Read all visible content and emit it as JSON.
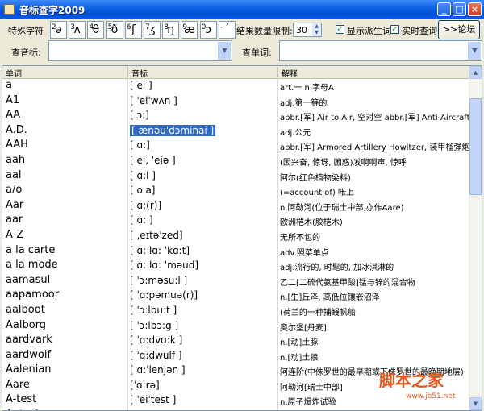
{
  "window": {
    "title": "音标查字2009"
  },
  "toolbar": {
    "special_chars_label": "特殊字符",
    "symbols": [
      {
        "sup": "2",
        "glyph": "ə"
      },
      {
        "sup": "3",
        "glyph": "ʌ"
      },
      {
        "sup": "4",
        "glyph": "θ"
      },
      {
        "sup": "5",
        "glyph": "ð"
      },
      {
        "sup": "6",
        "glyph": "ʃ"
      },
      {
        "sup": "7",
        "glyph": "ʒ"
      },
      {
        "sup": "8",
        "glyph": "ŋ"
      },
      {
        "sup": "9",
        "glyph": "æ"
      },
      {
        "sup": "0",
        "glyph": "ɔ"
      },
      {
        "sup": "-",
        "glyph": "ˊ"
      }
    ],
    "result_limit_label": "结果数量限制:",
    "result_limit_value": "30",
    "show_derived_label": "显示派生词",
    "live_query_label": "实时查询",
    "forum_label": ">>论坛"
  },
  "search": {
    "phonetic_label": "查音标:",
    "phonetic_value": "",
    "word_label": "查单词:",
    "word_value": ""
  },
  "list": {
    "columns": [
      "单词",
      "音标",
      "解释"
    ],
    "rows": [
      {
        "word": "a",
        "phonetic": "[ ei ]",
        "definition": "art.一 n.字母A"
      },
      {
        "word": "A1",
        "phonetic": "[ ˈeiˈwʌn ]",
        "definition": "adj.第一等的"
      },
      {
        "word": "AA",
        "phonetic": "[ ɔ:]",
        "definition": "abbr.[军] Air to Air, 空对空 abbr.[军] Anti-Aircraft, 防空"
      },
      {
        "word": "A.D.",
        "phonetic": "[ ænəuˈdɔminai ]",
        "definition": "adj.公元",
        "selected": true
      },
      {
        "word": "AAH",
        "phonetic": "[ ɑ:]",
        "definition": "abbr.[军] Armored Artillery Howitzer, 装甲榴弹炮 ab"
      },
      {
        "word": "aah",
        "phonetic": "[ ei, ˈeiə ]",
        "definition": "(因兴奋, 惊讶, 困惑)发啊啊声, 惊呼"
      },
      {
        "word": "aal",
        "phonetic": "[ ɑ:l ]",
        "definition": "阿尔(红色植物染料)"
      },
      {
        "word": "a/o",
        "phonetic": "[ o.a]",
        "definition": "(=account of) 帐上"
      },
      {
        "word": "Aar",
        "phonetic": "[ ɑ:(r)]",
        "definition": "n.阿勒河(位于瑞士中部,亦作Aare)"
      },
      {
        "word": "aar",
        "phonetic": "[ ɑ: ]",
        "definition": "欧洲桤木(胶桤木)"
      },
      {
        "word": "A-Z",
        "phonetic": "[ ,eɪtəˈzed]",
        "definition": "无所不包的"
      },
      {
        "word": "a la carte",
        "phonetic": "[ ɑ: lɑ: ˈkɑ:t]",
        "definition": "adv.照菜单点"
      },
      {
        "word": "a la mode",
        "phonetic": "[ ɑ: lɑ: ˈməud]",
        "definition": "adj.流行的, 时髦的, 加冰淇淋的"
      },
      {
        "word": "aamasul",
        "phonetic": "[ ˈɔ:məsu:l ]",
        "definition": "乙二[二硫代氨基甲酸]锰与锌的混合物"
      },
      {
        "word": "aapamoor",
        "phonetic": "[ ˈɑ:pəmuə(r)]",
        "definition": "n.[生]丘泽, 高低位镶嵌沼泽"
      },
      {
        "word": "aalboot",
        "phonetic": "[ ˈɔ:lbu:t ]",
        "definition": "(荷兰的一种捕鳗帆船"
      },
      {
        "word": "Aalborg",
        "phonetic": "[ ˈɔ:lbɔ:g ]",
        "definition": "奥尔堡[丹麦]"
      },
      {
        "word": "aardvark",
        "phonetic": "[ ˈɑ:dvɑ:k ]",
        "definition": "n.[动]土豚"
      },
      {
        "word": "aardwolf",
        "phonetic": "[ ˈɑ:dwulf ]",
        "definition": "n.[动]土狼"
      },
      {
        "word": "Aalenian",
        "phonetic": "[ ɑ:ˈlenjən ]",
        "definition": "阿连阶(中侏罗世的最早期或下侏罗世的最晚期地层)"
      },
      {
        "word": "Aare",
        "phonetic": "[ˈɑ:rə]",
        "definition": "阿勒河[瑞士中部]"
      },
      {
        "word": "A-test",
        "phonetic": "[ ˈeiˈtest ]",
        "definition": "n.原子爆炸试验"
      },
      {
        "word": "Aateck",
        "phonetic": "[ ˈætek ]",
        "definition": "福代硫(杀菌剂)"
      }
    ]
  },
  "watermark": {
    "brand": "脚本之家",
    "url": "www.jb51.net"
  },
  "colors": {
    "titlebar": "#0a5fe0",
    "selection": "#316ac5",
    "watermark": "#e8551a"
  }
}
